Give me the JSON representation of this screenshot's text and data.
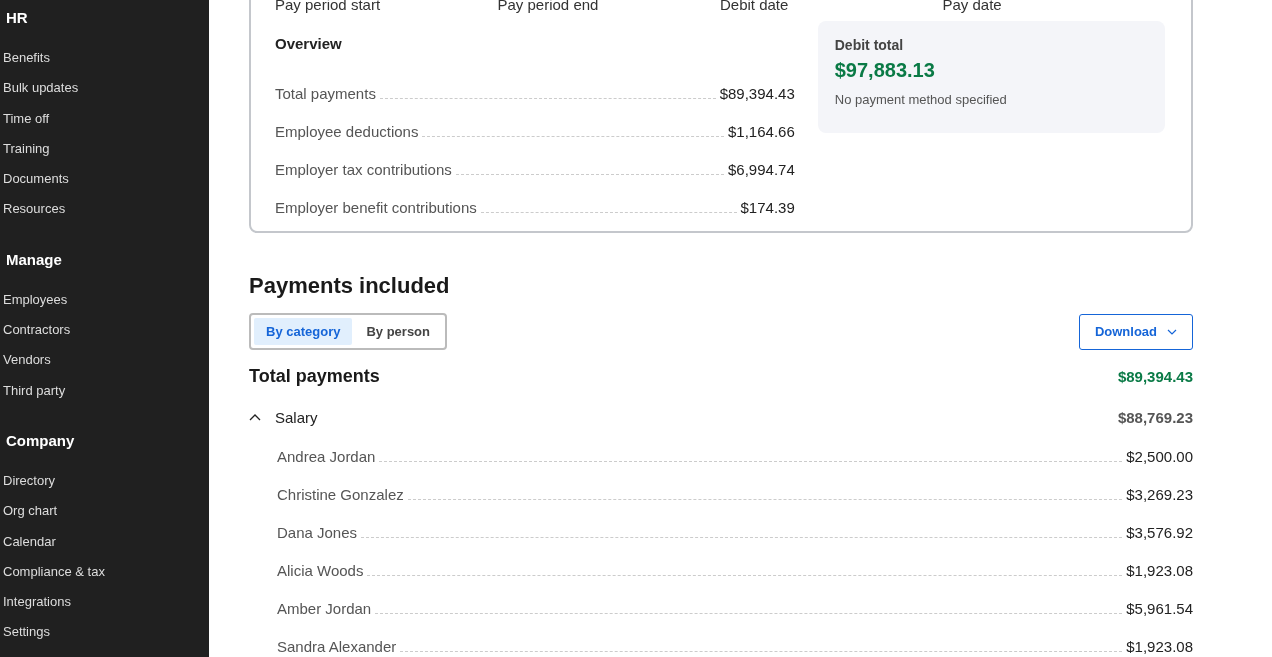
{
  "sidebar": {
    "sections": [
      {
        "title": "HR",
        "items": [
          {
            "label": "Benefits"
          },
          {
            "label": "Bulk updates"
          },
          {
            "label": "Time off"
          },
          {
            "label": "Training"
          },
          {
            "label": "Documents"
          },
          {
            "label": "Resources"
          }
        ]
      },
      {
        "title": "Manage",
        "items": [
          {
            "label": "Employees"
          },
          {
            "label": "Contractors"
          },
          {
            "label": "Vendors"
          },
          {
            "label": "Third party"
          }
        ]
      },
      {
        "title": "Company",
        "items": [
          {
            "label": "Directory"
          },
          {
            "label": "Org chart"
          },
          {
            "label": "Calendar"
          },
          {
            "label": "Compliance & tax"
          },
          {
            "label": "Integrations"
          },
          {
            "label": "Settings"
          }
        ]
      }
    ]
  },
  "summary": {
    "columns": [
      "Pay period start",
      "Pay period end",
      "Debit date",
      "Pay date"
    ],
    "overview_title": "Overview",
    "overview": [
      {
        "label": "Total payments",
        "amount": "$89,394.43"
      },
      {
        "label": "Employee deductions",
        "amount": "$1,164.66"
      },
      {
        "label": "Employer tax contributions",
        "amount": "$6,994.74"
      },
      {
        "label": "Employer benefit contributions",
        "amount": "$174.39"
      }
    ],
    "debit": {
      "title": "Debit total",
      "amount": "$97,883.13",
      "note": "No payment method specified"
    }
  },
  "payments": {
    "title": "Payments included",
    "tabs": [
      {
        "label": "By category",
        "selected": true
      },
      {
        "label": "By person",
        "selected": false
      }
    ],
    "download": "Download",
    "total_label": "Total payments",
    "total_amount": "$89,394.43",
    "groups": [
      {
        "label": "Salary",
        "amount": "$88,769.23",
        "expanded": true,
        "rows": [
          {
            "name": "Andrea Jordan",
            "amount": "$2,500.00"
          },
          {
            "name": "Christine Gonzalez",
            "amount": "$3,269.23"
          },
          {
            "name": "Dana Jones",
            "amount": "$3,576.92"
          },
          {
            "name": "Alicia Woods",
            "amount": "$1,923.08"
          },
          {
            "name": "Amber Jordan",
            "amount": "$5,961.54"
          },
          {
            "name": "Sandra Alexander",
            "amount": "$1,923.08"
          }
        ]
      }
    ]
  }
}
